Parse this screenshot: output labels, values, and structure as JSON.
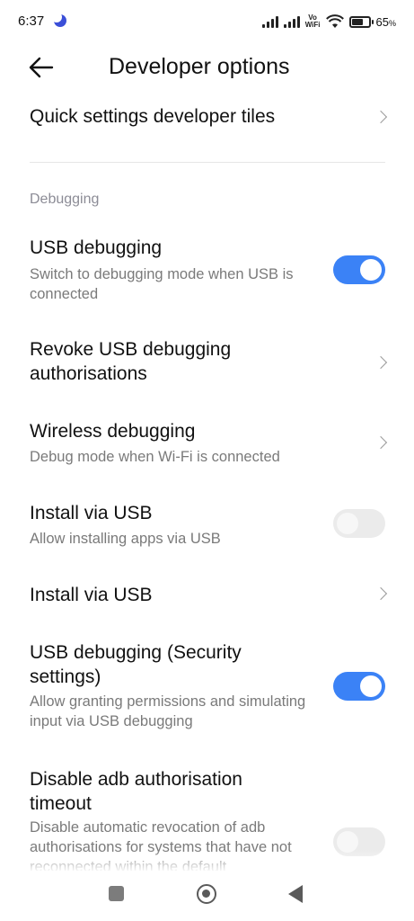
{
  "status_bar": {
    "time": "6:37",
    "vowifi_top": "Vo",
    "vowifi_bottom": "WiFi",
    "battery_level": 65,
    "battery_pct": "65",
    "battery_unit": "%"
  },
  "header": {
    "title": "Developer options",
    "back_icon": "arrow-left-icon"
  },
  "items": {
    "quick_tiles": {
      "title": "Quick settings developer tiles"
    },
    "section": {
      "label": "Debugging"
    },
    "usb_debugging": {
      "title": "USB debugging",
      "subtitle": "Switch to debugging mode when USB is connected",
      "enabled": true
    },
    "revoke": {
      "title": "Revoke USB debugging authorisations"
    },
    "wireless": {
      "title": "Wireless debugging",
      "subtitle": "Debug mode when Wi-Fi is connected"
    },
    "install_toggle": {
      "title": "Install via USB",
      "subtitle": "Allow installing apps via USB",
      "enabled": false
    },
    "install_link": {
      "title": "Install via USB"
    },
    "usb_security": {
      "title": "USB debugging (Security settings)",
      "subtitle": "Allow granting permissions and simulating input via USB debugging",
      "enabled": true
    },
    "adb_timeout": {
      "title": "Disable adb authorisation timeout",
      "subtitle": "Disable automatic revocation of adb authorisations for systems that have not reconnected within the default",
      "enabled": false
    }
  },
  "colors": {
    "accent": "#3b82f6",
    "toggle_off": "#ebebeb",
    "secondary_text": "#7a7a7a"
  },
  "nav_bar": {
    "recents_icon": "square-recents-icon",
    "home_icon": "circle-home-icon",
    "back_icon": "triangle-back-icon"
  }
}
